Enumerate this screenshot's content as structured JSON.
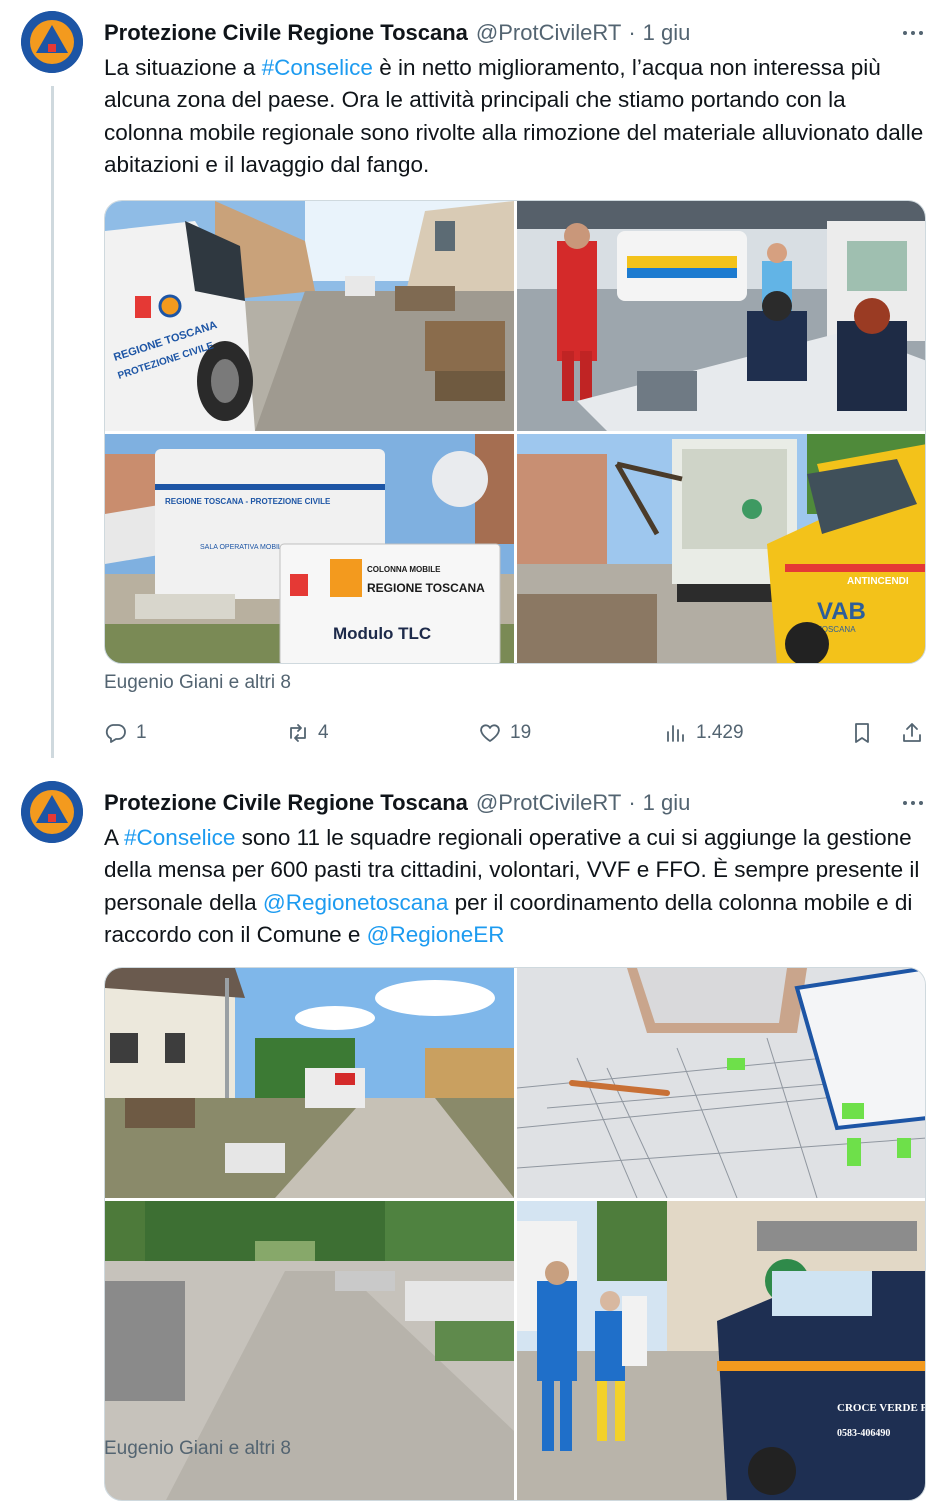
{
  "tweets": [
    {
      "author_name": "Protezione Civile Regione Toscana",
      "handle": "@ProtCivileRT",
      "separator": "·",
      "time": "1 giu",
      "text_parts": [
        {
          "text": "La situazione a ",
          "link": false
        },
        {
          "text": "#Conselice",
          "link": true
        },
        {
          "text": " è in netto miglioramento, l’acqua non interessa più alcuna zona del paese. Ora le attività principali che stiamo portando con la colonna mobile regionale sono rivolte alla rimozione del materiale alluvionato dalle abitazioni e il lavaggio dal fango.",
          "link": false
        }
      ],
      "photo_texts": {
        "car_door_1": "REGIONE TOSCANA",
        "car_door_2": "PROTEZIONE CIVILE",
        "module_title": "COLONNA MOBILE",
        "module_region": "REGIONE TOSCANA",
        "module_name": "Modulo TLC",
        "van_banner": "REGIONE TOSCANA - PROTEZIONE CIVILE",
        "van_sub": "SALA OPERATIVA MOBILE",
        "truck_label": "ANTINCENDI",
        "truck_logo": "VAB",
        "truck_region": "TOSCANA"
      },
      "tagged": "Eugenio Giani e altri 8",
      "stats": {
        "replies": "1",
        "retweets": "4",
        "likes": "19",
        "views": "1.429"
      }
    },
    {
      "author_name": "Protezione Civile Regione Toscana",
      "handle": "@ProtCivileRT",
      "separator": "·",
      "time": "1 giu",
      "text_parts": [
        {
          "text": "A ",
          "link": false
        },
        {
          "text": "#Conselice",
          "link": true
        },
        {
          "text": " sono 11 le squadre regionali operative a cui si aggiunge la gestione della mensa per 600 pasti tra cittadini, volontari, VVF e FFO. È sempre presente il personale della ",
          "link": false
        },
        {
          "text": "@Regionetoscana",
          "link": true
        },
        {
          "text": " per il coordinamento della colonna mobile e di raccordo con il Comune e ",
          "link": false
        },
        {
          "text": "@RegioneER",
          "link": true
        }
      ],
      "photo_texts": {
        "ambulance_1": "CROCE VERDE P.A",
        "ambulance_2": "0583-406490"
      },
      "tagged": "Eugenio Giani e altri 8"
    }
  ],
  "icons": [
    "avatar-logo",
    "more-icon",
    "reply-icon",
    "retweet-icon",
    "like-icon",
    "views-icon",
    "bookmark-icon",
    "share-icon"
  ],
  "colors": {
    "link": "#1d9bf0",
    "secondary": "#536471",
    "border": "#cfd9de",
    "avatar_bg": "#1d55a5",
    "logo_orange": "#f39a1e"
  }
}
